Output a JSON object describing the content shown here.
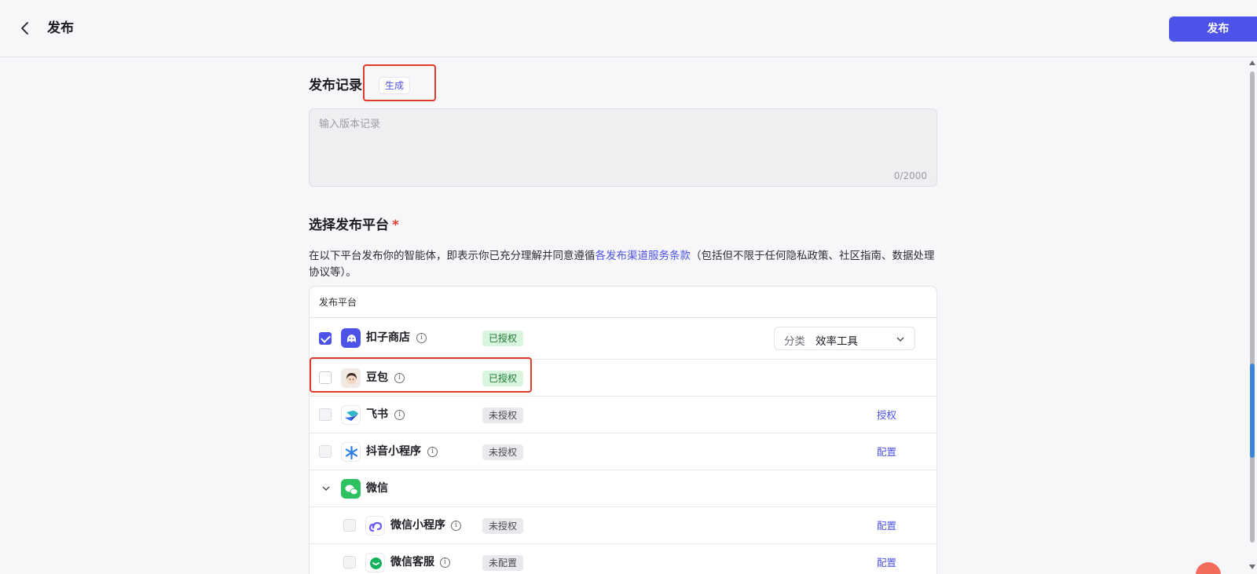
{
  "header": {
    "title": "发布",
    "publish_label": "发布",
    "back_icon": "chevron-left-icon"
  },
  "record": {
    "title": "发布记录",
    "generate_label": "生成",
    "placeholder": "输入版本记录",
    "counter": "0/2000"
  },
  "platform": {
    "title": "选择发布平台",
    "required_mark": "*",
    "desc_before": "在以下平台发布你的智能体，即表示你已充分理解并同意遵循",
    "desc_link": "各发布渠道服务条款",
    "desc_after": "（包括但不限于任何隐私政策、社区指南、数据处理协议等）。",
    "column_header": "发布平台",
    "rows": [
      {
        "name": "扣子商店",
        "status": "已授权",
        "status_type": "authorized",
        "checked": true,
        "category_label": "分类",
        "category_value": "效率工具"
      },
      {
        "name": "豆包",
        "status": "已授权",
        "status_type": "authorized",
        "checked": false
      },
      {
        "name": "飞书",
        "status": "未授权",
        "status_type": "unauthorized",
        "checked": false,
        "action": "授权"
      },
      {
        "name": "抖音小程序",
        "status": "未授权",
        "status_type": "unauthorized",
        "checked": false,
        "action": "配置"
      },
      {
        "name": "微信",
        "group": true,
        "expanded": true
      },
      {
        "name": "微信小程序",
        "status": "未授权",
        "status_type": "unauthorized",
        "checked": false,
        "action": "配置"
      },
      {
        "name": "微信客服",
        "status": "未配置",
        "status_type": "unconfigured",
        "checked": false,
        "action": "配置"
      }
    ]
  },
  "colors": {
    "accent": "#4d53e8",
    "authorized_bg": "#d9f5de",
    "authorized_text": "#1f7a33",
    "highlight": "#e03a2f"
  }
}
